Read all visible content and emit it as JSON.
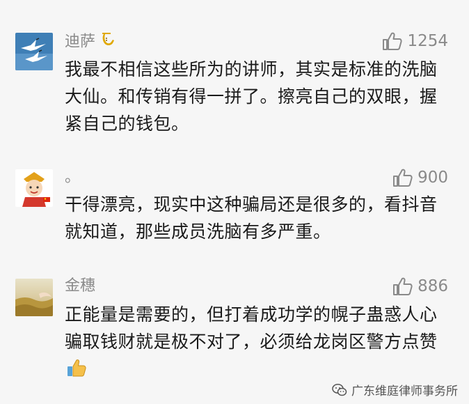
{
  "comments": [
    {
      "username": "迪萨",
      "likes": "1254",
      "text": "我最不相信这些所为的讲师，其实是标准的洗脑大仙。和传销有得一拼了。擦亮自己的双眼，握紧自己的钱包。",
      "avatar_icon": "crane-avatar",
      "badge_icon": "saxophone-icon"
    },
    {
      "username": "。",
      "likes": "900",
      "text": "干得漂亮，现实中这种骗局还是很多的，看抖音就知道，那些成员洗脑有多严重。",
      "avatar_icon": "cartoon-monk-avatar"
    },
    {
      "username": "金穗",
      "likes": "886",
      "text": "正能量是需要的，但打着成功学的幌子蛊惑人心骗取钱财就是极不对了，必须给龙岗区警方点赞",
      "avatar_icon": "wheat-field-avatar",
      "emoji_icon": "thumbs-up-emoji-icon"
    }
  ],
  "watermark": {
    "text": "广东维庭律师事务所",
    "icon": "wechat-icon"
  },
  "colors": {
    "background": "#f6f6f6",
    "username": "#8a8a8a",
    "body_text": "#1a1a1a"
  }
}
